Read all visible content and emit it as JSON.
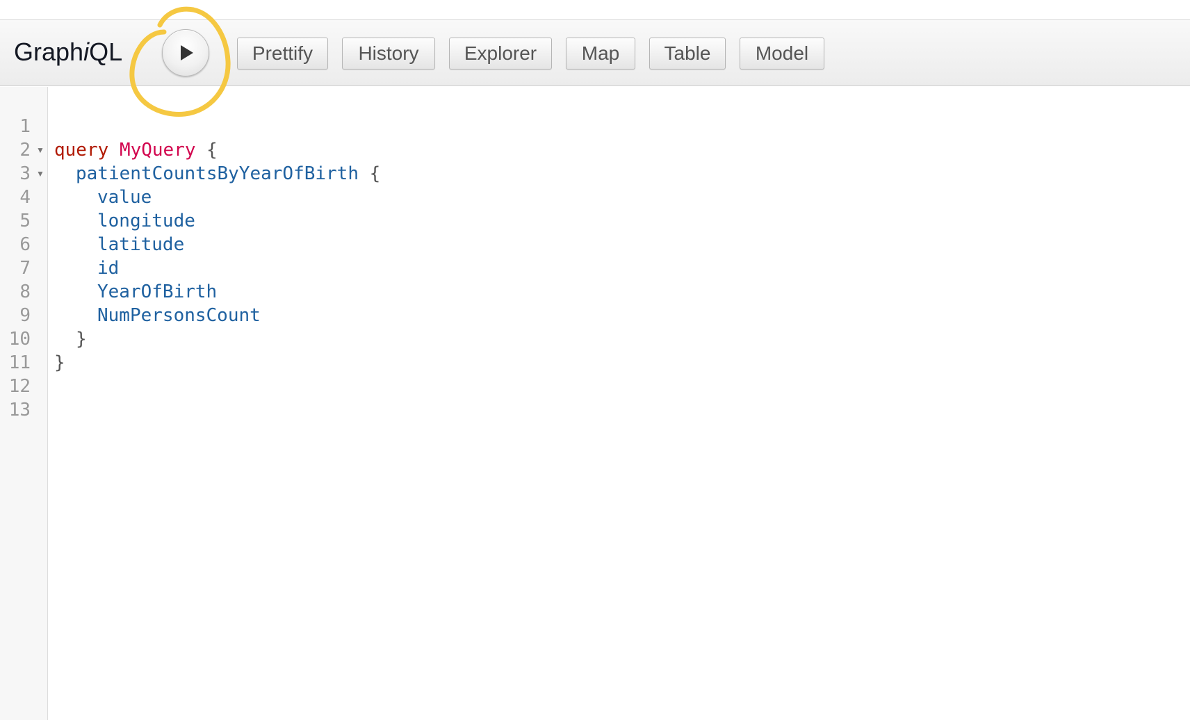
{
  "app": {
    "brand_prefix": "Graph",
    "brand_italic": "i",
    "brand_suffix": "QL"
  },
  "toolbar": {
    "run_icon": "play-icon",
    "buttons": [
      {
        "label": "Prettify"
      },
      {
        "label": "History"
      },
      {
        "label": "Explorer"
      },
      {
        "label": "Map"
      },
      {
        "label": "Table"
      },
      {
        "label": "Model"
      }
    ]
  },
  "annotation": {
    "color": "#f5c842"
  },
  "editor": {
    "line_numbers": [
      "1",
      "2",
      "3",
      "4",
      "5",
      "6",
      "7",
      "8",
      "9",
      "10",
      "11",
      "12",
      "13"
    ],
    "fold_markers": {
      "line2": "▼",
      "line3": "▼"
    },
    "lines": {
      "l2_keyword": "query",
      "l2_name": "MyQuery",
      "l2_brace": "{",
      "l3_field": "patientCountsByYearOfBirth",
      "l3_brace": "{",
      "l4": "value",
      "l5": "longitude",
      "l6": "latitude",
      "l7": "id",
      "l8": "YearOfBirth",
      "l9": "NumPersonsCount",
      "l10": "}",
      "l11": "}"
    }
  },
  "colors": {
    "keyword": "#b11a04",
    "definition": "#d2054e",
    "property": "#1f61a0",
    "punctuation": "#555555"
  }
}
